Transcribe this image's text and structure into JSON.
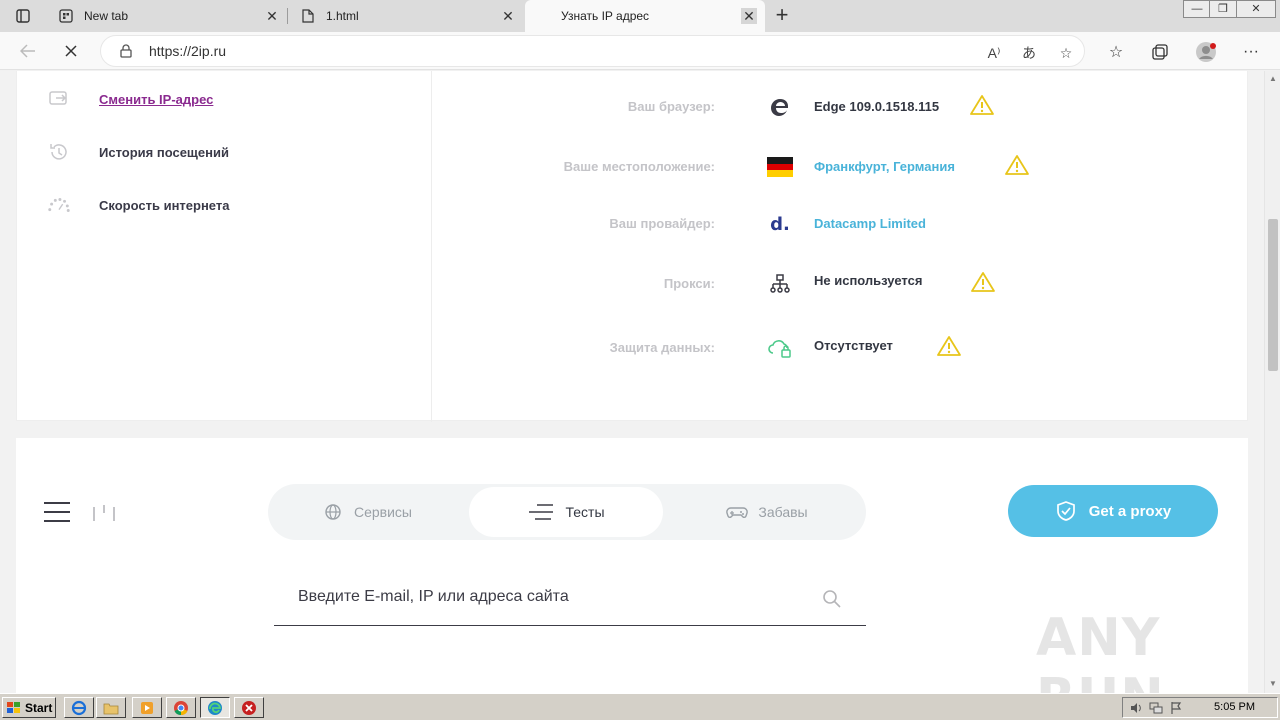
{
  "browser": {
    "tabs": [
      {
        "title": "New tab",
        "icon": "new-tab-page-icon",
        "active": false
      },
      {
        "title": "1.html",
        "icon": "document-icon",
        "active": false
      },
      {
        "title": "Узнать IP адрес",
        "icon": "",
        "active": true
      }
    ],
    "url": "https://2ip.ru"
  },
  "sidebar": {
    "items": [
      {
        "label": "Сменить IP-адрес",
        "icon": "switch-ip-icon"
      },
      {
        "label": "История посещений",
        "icon": "history-icon"
      },
      {
        "label": "Скорость интернета",
        "icon": "speed-icon"
      }
    ]
  },
  "info": {
    "rows": [
      {
        "label": "Ваш браузер:",
        "value": "Edge 109.0.1518.115",
        "icon": "edge-logo-icon",
        "warning": true
      },
      {
        "label": "Ваше местоположение:",
        "value": "Франкфурт, Германия",
        "icon": "germany-flag-icon",
        "warning": true
      },
      {
        "label": "Ваш провайдер:",
        "value": "Datacamp Limited",
        "icon": "provider-logo-icon",
        "warning": false
      },
      {
        "label": "Прокси:",
        "value": "Не используется",
        "icon": "proxy-network-icon",
        "warning": true
      },
      {
        "label": "Защита данных:",
        "value": "Отсутствует",
        "icon": "cloud-lock-icon",
        "warning": true
      }
    ],
    "provider_logo_text": "d."
  },
  "nav": {
    "tabs": [
      {
        "label": "Сервисы",
        "icon": "globe-icon",
        "active": false
      },
      {
        "label": "Тесты",
        "icon": "tests-icon",
        "active": true
      },
      {
        "label": "Забавы",
        "icon": "gamepad-icon",
        "active": false
      }
    ],
    "proxy_button": "Get a proxy"
  },
  "search": {
    "placeholder": "Введите E-mail, IP или адреса сайта"
  },
  "taskbar": {
    "start_label": "Start",
    "clock": "5:05 PM"
  },
  "watermark": "ANY RUN",
  "colors": {
    "accent": "#55c0e6",
    "link": "#49b3d9",
    "visited_link": "#8a2a8f",
    "warning": "#e8c51a"
  }
}
